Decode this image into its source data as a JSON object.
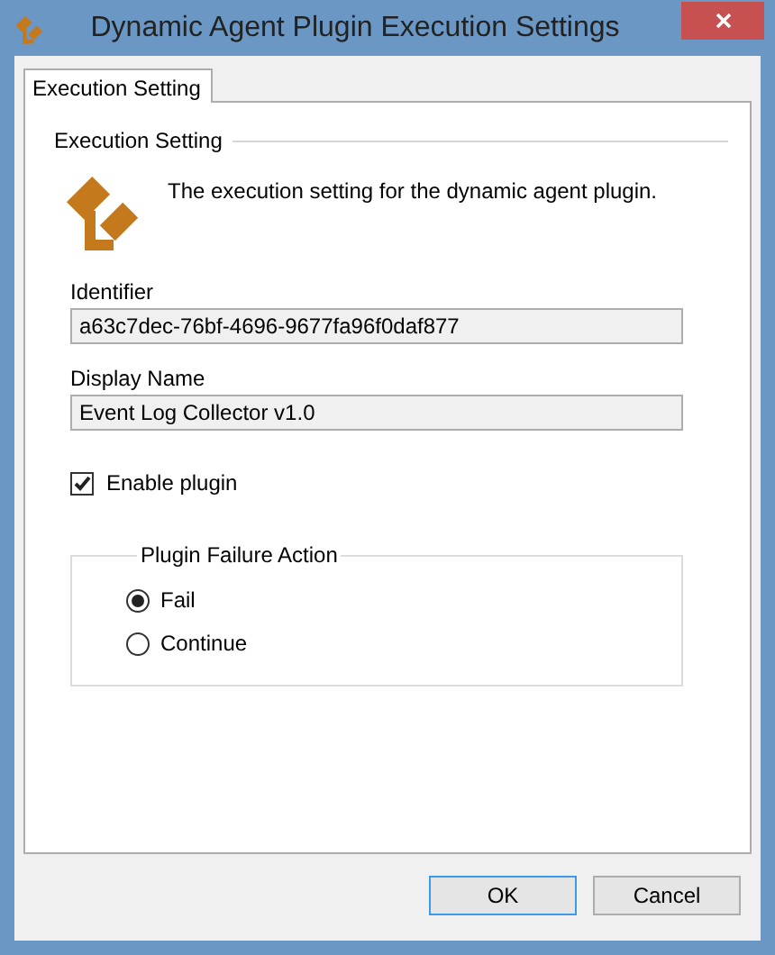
{
  "window": {
    "title": "Dynamic Agent Plugin Execution Settings"
  },
  "tabs": [
    {
      "label": "Execution Setting",
      "selected": true
    }
  ],
  "section": {
    "title": "Execution Setting",
    "description": "The execution setting for the dynamic agent plugin."
  },
  "fields": [
    {
      "label": "Identifier",
      "value": "a63c7dec-76bf-4696-9677fa96f0daf877"
    },
    {
      "label": "Display Name",
      "value": "Event Log Collector v1.0"
    }
  ],
  "enable_plugin": {
    "label": "Enable plugin",
    "checked": true
  },
  "failure_action": {
    "title": "Plugin Failure Action",
    "options": [
      {
        "label": "Fail",
        "selected": true
      },
      {
        "label": "Continue",
        "selected": false
      }
    ]
  },
  "buttons": [
    {
      "label": "OK",
      "default": true
    },
    {
      "label": "Cancel",
      "default": false
    }
  ]
}
